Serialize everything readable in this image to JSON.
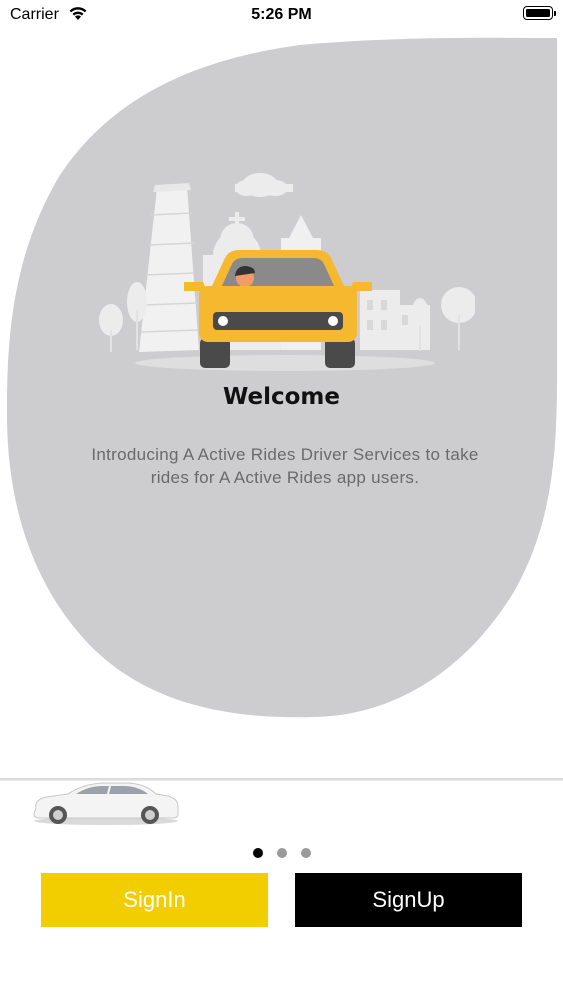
{
  "status_bar": {
    "carrier": "Carrier",
    "time": "5:26 PM"
  },
  "onboarding": {
    "title": "Welcome",
    "description": "Introducing A Active Rides  Driver Services to take rides for A Active Rides  app users.",
    "page_count": 3,
    "current_page": 1
  },
  "actions": {
    "signin_label": "SignIn",
    "signup_label": "SignUp"
  },
  "colors": {
    "accent": "#f2cd00",
    "blob": "#cdcdcf",
    "signup": "#000000"
  }
}
